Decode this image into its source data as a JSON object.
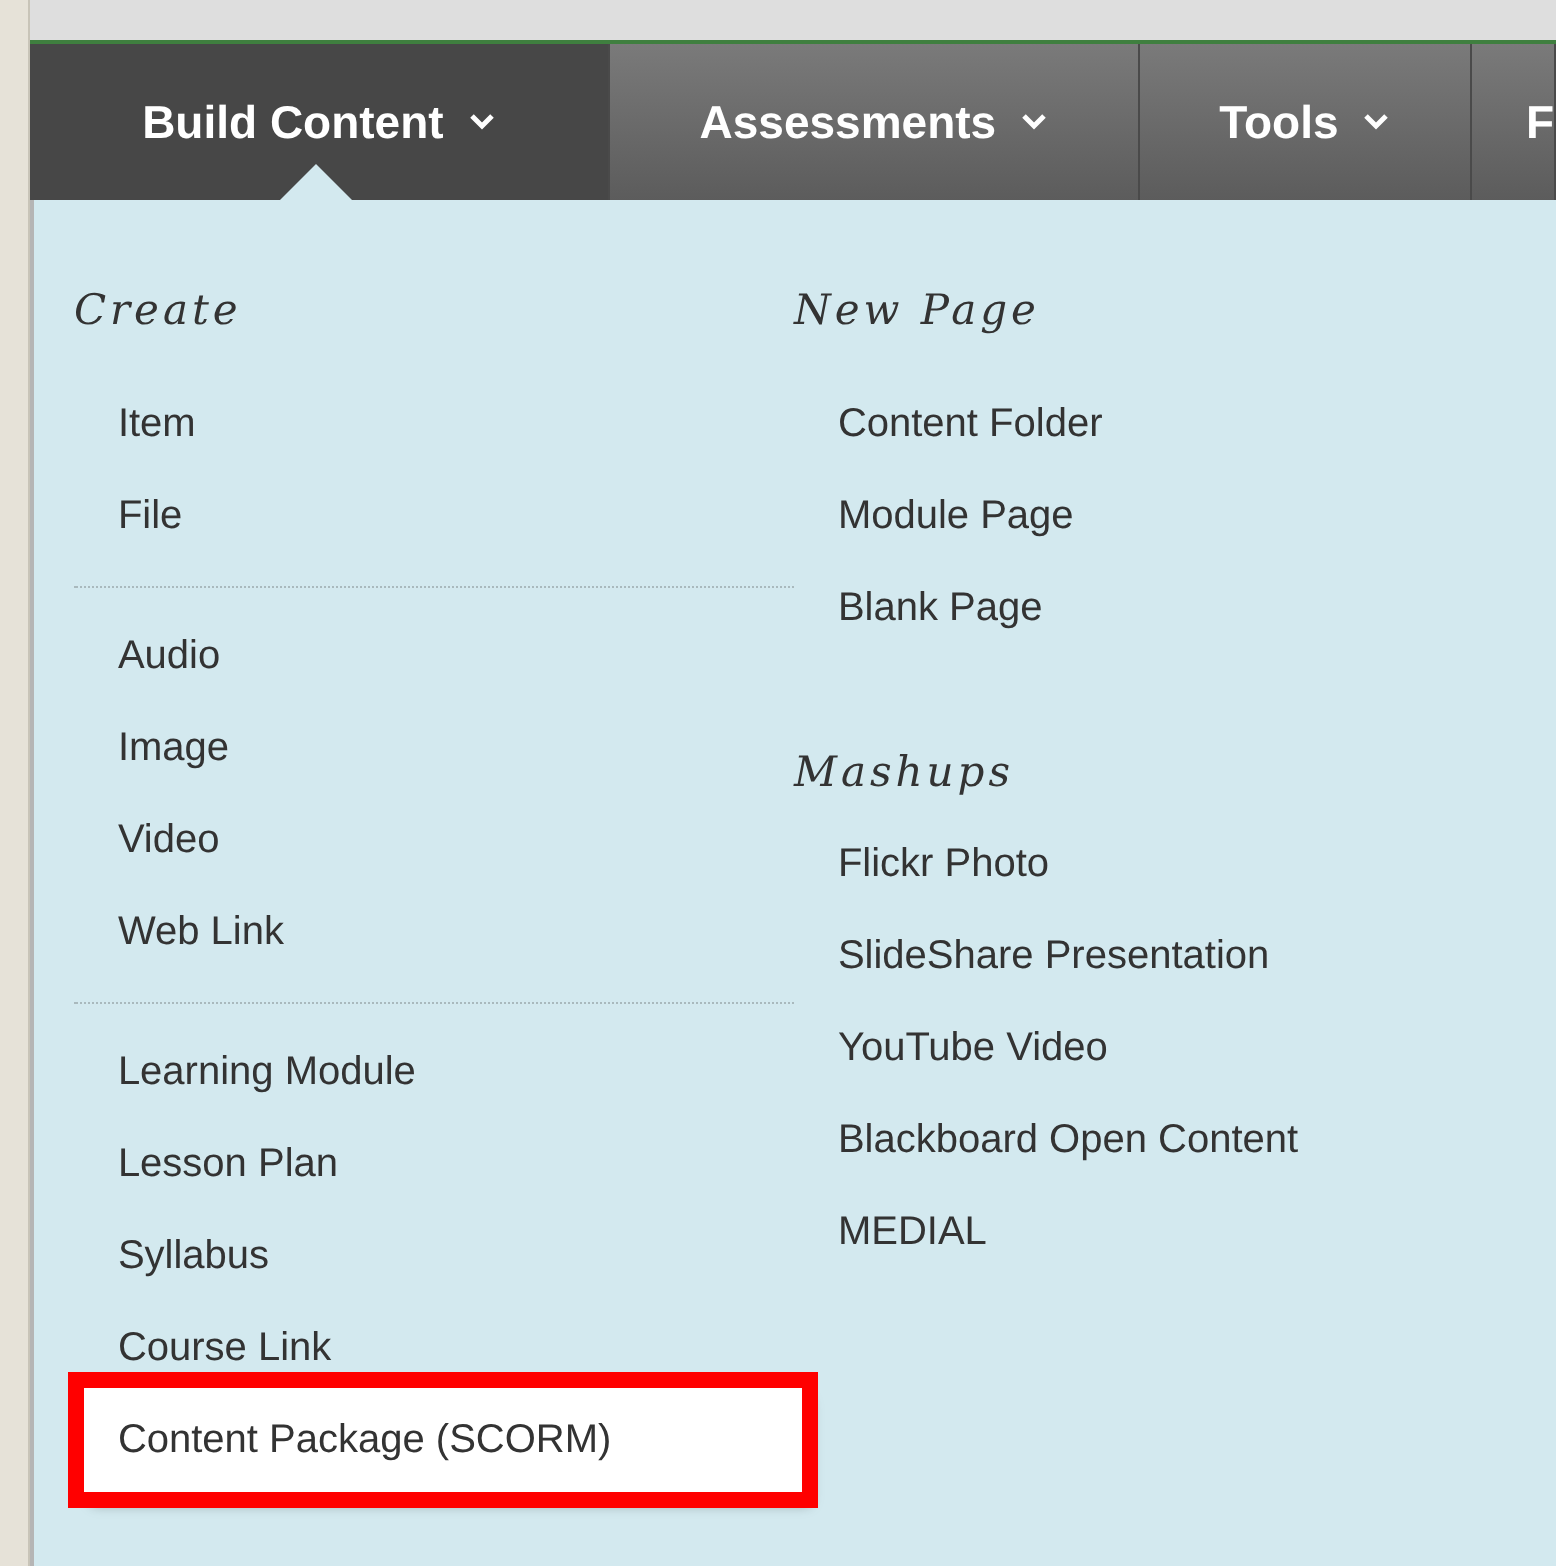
{
  "tabs": [
    {
      "label": "Build Content",
      "selected": true
    },
    {
      "label": "Assessments",
      "selected": false
    },
    {
      "label": "Tools",
      "selected": false
    },
    {
      "label": "F",
      "selected": false
    }
  ],
  "menu": {
    "columns": [
      {
        "sections": [
          {
            "heading": "Create",
            "groups": [
              [
                {
                  "label": "Item",
                  "selected": false
                },
                {
                  "label": "File",
                  "selected": false
                }
              ],
              [
                {
                  "label": "Audio",
                  "selected": false
                },
                {
                  "label": "Image",
                  "selected": false
                },
                {
                  "label": "Video",
                  "selected": false
                },
                {
                  "label": "Web Link",
                  "selected": false
                }
              ],
              [
                {
                  "label": "Learning Module",
                  "selected": false
                },
                {
                  "label": "Lesson Plan",
                  "selected": false
                },
                {
                  "label": "Syllabus",
                  "selected": false
                },
                {
                  "label": "Course Link",
                  "selected": false
                },
                {
                  "label": "Content Package (SCORM)",
                  "selected": true
                }
              ]
            ]
          }
        ]
      },
      {
        "sections": [
          {
            "heading": "New Page",
            "groups": [
              [
                {
                  "label": "Content Folder",
                  "selected": false
                },
                {
                  "label": "Module Page",
                  "selected": false
                },
                {
                  "label": "Blank Page",
                  "selected": false
                }
              ]
            ]
          },
          {
            "heading": "Mashups",
            "groups": [
              [
                {
                  "label": "Flickr Photo",
                  "selected": false
                },
                {
                  "label": "SlideShare Presentation",
                  "selected": false
                },
                {
                  "label": "YouTube Video",
                  "selected": false
                },
                {
                  "label": "Blackboard Open Content",
                  "selected": false
                },
                {
                  "label": "MEDIAL",
                  "selected": false
                }
              ]
            ]
          }
        ]
      }
    ]
  }
}
